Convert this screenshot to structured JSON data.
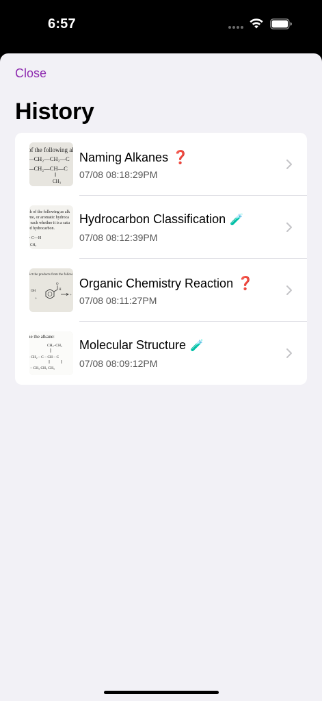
{
  "status_bar": {
    "time": "6:57"
  },
  "sheet": {
    "close_label": "Close",
    "title": "History"
  },
  "history": [
    {
      "title": "Naming Alkanes",
      "emoji": "❓",
      "timestamp": "07/08 08:18:29PM",
      "thumb_icon": "alkane-structure-photo"
    },
    {
      "title": "Hydrocarbon Classification",
      "emoji": "🧪",
      "timestamp": "07/08 08:12:39PM",
      "thumb_icon": "worksheet-text-photo"
    },
    {
      "title": "Organic Chemistry Reaction",
      "emoji": "❓",
      "timestamp": "07/08 08:11:27PM",
      "thumb_icon": "benzene-reaction-photo"
    },
    {
      "title": "Molecular Structure",
      "emoji": "🧪",
      "timestamp": "07/08 08:09:12PM",
      "thumb_icon": "alkane-drawing-photo"
    }
  ],
  "colors": {
    "accent": "#8e2bb0",
    "sheet_background": "#f2f1f6",
    "card_background": "#ffffff",
    "question_mark": "#d61d2b"
  }
}
